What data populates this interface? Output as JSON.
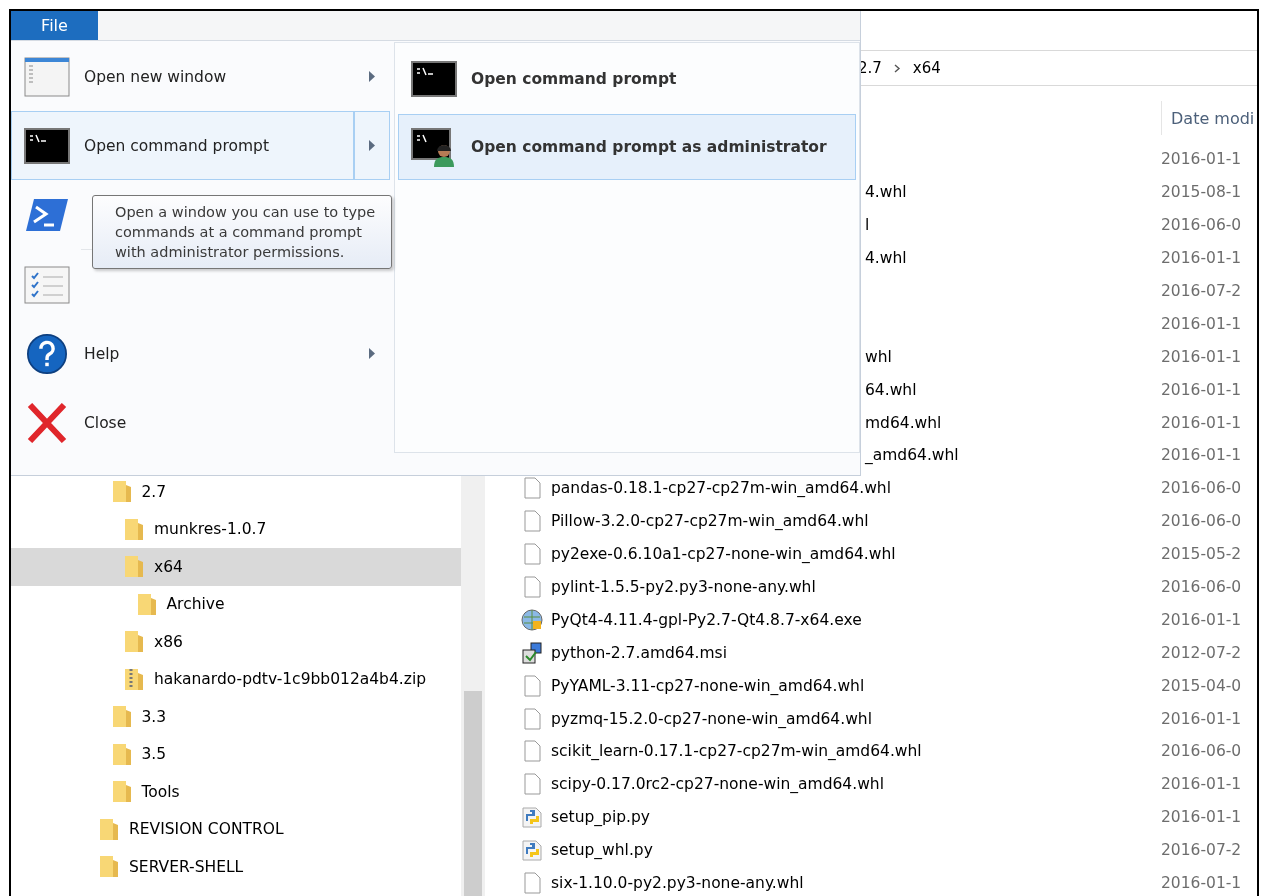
{
  "menu": {
    "tab": {
      "label": "File",
      "selected": true
    },
    "items": [
      {
        "label": "Open new window",
        "kind": "window",
        "submenu": true,
        "selected": false,
        "separator": false
      },
      {
        "label": "Open command prompt",
        "kind": "cmd",
        "submenu": true,
        "selected": true,
        "separator": false
      },
      {
        "kind": "powershell",
        "submenu": false,
        "selected": false,
        "separator": false
      },
      {
        "kind": "options",
        "submenu": false,
        "selected": false,
        "separator": true
      },
      {
        "label": "Help",
        "kind": "help",
        "submenu": true,
        "selected": false,
        "separator": false
      },
      {
        "label": "Close",
        "kind": "close",
        "submenu": false,
        "selected": false,
        "separator": false
      }
    ],
    "submenu": [
      {
        "label": "Open command prompt",
        "kind": "cmd",
        "selected": false
      },
      {
        "label": "Open command prompt as administrator",
        "kind": "cmd-admin",
        "selected": true
      }
    ],
    "tooltip": "Open a window you can use to type commands at a command prompt with administrator permissions."
  },
  "address": {
    "crumbs": [
      "2.7",
      "x64"
    ]
  },
  "columns": [
    {
      "label": "Date modi"
    }
  ],
  "tree": {
    "continued_children": [
      {
        "label": "2.7",
        "kind": "folder",
        "selected": false,
        "children": [
          {
            "label": "munkres-1.0.7",
            "kind": "folder",
            "selected": false
          },
          {
            "label": "x64",
            "kind": "folder",
            "selected": true,
            "children": [
              {
                "label": "Archive",
                "kind": "folder",
                "selected": false
              }
            ]
          },
          {
            "label": "x86",
            "kind": "folder",
            "selected": false
          },
          {
            "label": "hakanardo-pdtv-1c9bb012a4b4.zip",
            "kind": "zip",
            "selected": false
          }
        ]
      },
      {
        "label": "3.3",
        "kind": "folder",
        "selected": false
      },
      {
        "label": "3.5",
        "kind": "folder",
        "selected": false
      },
      {
        "label": "Tools",
        "kind": "folder",
        "selected": false
      }
    ],
    "items": [
      {
        "label": "REVISION CONTROL",
        "kind": "folder",
        "selected": false
      },
      {
        "label": "SERVER-SHELL",
        "kind": "folder",
        "selected": false
      }
    ]
  },
  "files": [
    {
      "kind": "covered",
      "date": "2016-01-1"
    },
    {
      "kind": "covered",
      "name": "4.whl",
      "date": "2015-08-1"
    },
    {
      "kind": "covered",
      "name": "l",
      "date": "2016-06-0"
    },
    {
      "kind": "covered",
      "name": "4.whl",
      "date": "2016-01-1"
    },
    {
      "kind": "covered",
      "date": "2016-07-2"
    },
    {
      "kind": "covered",
      "date": "2016-01-1"
    },
    {
      "kind": "covered",
      "name": "whl",
      "date": "2016-01-1"
    },
    {
      "kind": "covered",
      "name": "64.whl",
      "date": "2016-01-1"
    },
    {
      "kind": "covered",
      "name": "md64.whl",
      "date": "2016-01-1"
    },
    {
      "kind": "covered",
      "name": "_amd64.whl",
      "date": "2016-01-1"
    },
    {
      "name": "pandas-0.18.1-cp27-cp27m-win_amd64.whl",
      "kind": "file",
      "date": "2016-06-0"
    },
    {
      "name": "Pillow-3.2.0-cp27-cp27m-win_amd64.whl",
      "kind": "file",
      "date": "2016-06-0"
    },
    {
      "name": "py2exe-0.6.10a1-cp27-none-win_amd64.whl",
      "kind": "file",
      "date": "2015-05-2"
    },
    {
      "name": "pylint-1.5.5-py2.py3-none-any.whl",
      "kind": "file",
      "date": "2016-06-0"
    },
    {
      "name": "PyQt4-4.11.4-gpl-Py2.7-Qt4.8.7-x64.exe",
      "kind": "exe",
      "date": "2016-01-1"
    },
    {
      "name": "python-2.7.amd64.msi",
      "kind": "msi",
      "date": "2012-07-2"
    },
    {
      "name": "PyYAML-3.11-cp27-none-win_amd64.whl",
      "kind": "file",
      "date": "2015-04-0"
    },
    {
      "name": "pyzmq-15.2.0-cp27-none-win_amd64.whl",
      "kind": "file",
      "date": "2016-01-1"
    },
    {
      "name": "scikit_learn-0.17.1-cp27-cp27m-win_amd64.whl",
      "kind": "file",
      "date": "2016-06-0"
    },
    {
      "name": "scipy-0.17.0rc2-cp27-none-win_amd64.whl",
      "kind": "file",
      "date": "2016-01-1"
    },
    {
      "name": "setup_pip.py",
      "kind": "python",
      "date": "2016-01-1"
    },
    {
      "name": "setup_whl.py",
      "kind": "python",
      "date": "2016-07-2"
    },
    {
      "name": "six-1.10.0-py2.py3-none-any.whl",
      "kind": "file",
      "date": "2016-01-1"
    }
  ]
}
